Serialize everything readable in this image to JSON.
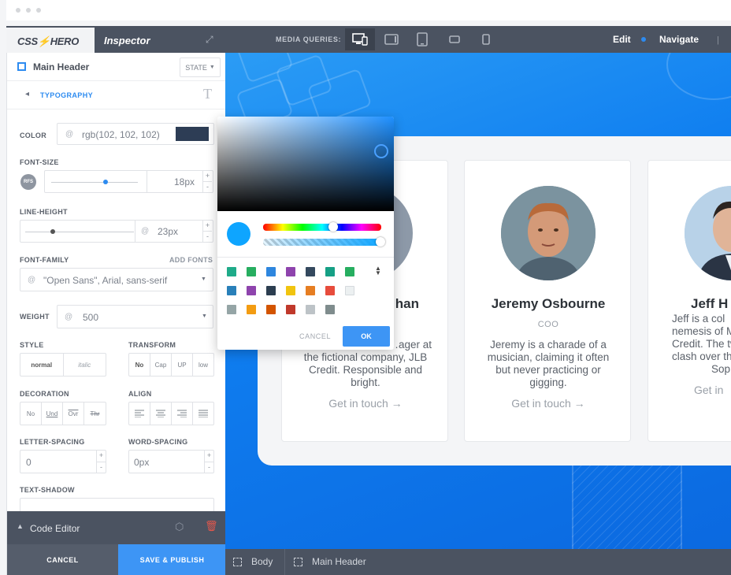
{
  "app": {
    "logo": "CSS⚡HERO",
    "panel_title": "Inspector"
  },
  "topbar": {
    "media_queries_label": "MEDIA QUERIES:",
    "edit_label": "Edit",
    "navigate_label": "Navigate",
    "devices": [
      "desktop-mobile-icon",
      "tablet-landscape-icon",
      "tablet-portrait-icon",
      "phone-landscape-icon",
      "phone-portrait-icon"
    ]
  },
  "inspector": {
    "element_name": "Main Header",
    "state_label": "STATE",
    "section_label": "TYPOGRAPHY",
    "color": {
      "label": "COLOR",
      "at": "@",
      "value": "rgb(102, 102, 102)",
      "swatch": "#2d3d55"
    },
    "font_size": {
      "label": "FONT-SIZE",
      "badge": "RFS",
      "value": "18px",
      "slider": 0.63
    },
    "line_height": {
      "label": "LINE-HEIGHT",
      "at": "@",
      "value": "23px",
      "slider": 0.25
    },
    "font_family": {
      "label": "FONT-FAMILY",
      "add_label": "ADD FONTS",
      "at": "@",
      "value": "\"Open Sans\", Arial, sans-serif"
    },
    "weight": {
      "label": "WEIGHT",
      "at": "@",
      "value": "500"
    },
    "style": {
      "label": "STYLE",
      "options": [
        "normal",
        "italic"
      ]
    },
    "transform": {
      "label": "TRANSFORM",
      "options": [
        "No",
        "Cap",
        "UP",
        "low"
      ]
    },
    "decoration": {
      "label": "DECORATION",
      "options": [
        "No",
        "Und",
        "Ovr",
        "Thr"
      ]
    },
    "align": {
      "label": "ALIGN",
      "options": [
        "align-left-icon",
        "align-center-icon",
        "align-right-icon",
        "align-justify-icon"
      ]
    },
    "letter_spacing": {
      "label": "LETTER-SPACING",
      "value": "0"
    },
    "word_spacing": {
      "label": "WORD-SPACING",
      "value": "0px"
    },
    "text_shadow": {
      "label": "TEXT-SHADOW"
    }
  },
  "code_editor": {
    "label": "Code Editor"
  },
  "footer": {
    "cancel_label": "CANCEL",
    "save_label": "SAVE & PUBLISH"
  },
  "color_picker": {
    "cancel_label": "CANCEL",
    "ok_label": "OK",
    "preview_color": "#0ea5ff",
    "swatches": [
      [
        "#1fab89",
        "#27ae60",
        "#2e86de",
        "#8e44ad",
        "#34495e",
        "#16a085",
        "#27ae60"
      ],
      [
        "#2980b9",
        "#8e44ad",
        "#2c3e50",
        "#f1c40f",
        "#e67e22",
        "#e74c3c",
        "#ecf0f1"
      ],
      [
        "#95a5a6",
        "#f39c12",
        "#d35400",
        "#c0392b",
        "#bdc3c7",
        "#7f8c8d"
      ]
    ]
  },
  "team": [
    {
      "name": "…han",
      "role": "",
      "bio_lines": [
        "…ager at",
        "the fictional company, JLB",
        "Credit. Responsible and",
        "bright."
      ],
      "cta": "Get in touch →"
    },
    {
      "name": "Jeremy Osbourne",
      "role": "COO",
      "bio_lines": [
        "Jeremy is a charade of a",
        "musician, claiming it often",
        "but never practicing or",
        "gigging."
      ],
      "cta": "Get in touch →"
    },
    {
      "name": "Jeff H",
      "role": "",
      "bio_lines": [
        "Jeff is a col",
        "nemesis of M",
        "Credit. The tw",
        "clash over the",
        "Sop"
      ],
      "cta": "Get in"
    }
  ],
  "breadcrumbs": [
    "Body",
    "Main Header"
  ]
}
